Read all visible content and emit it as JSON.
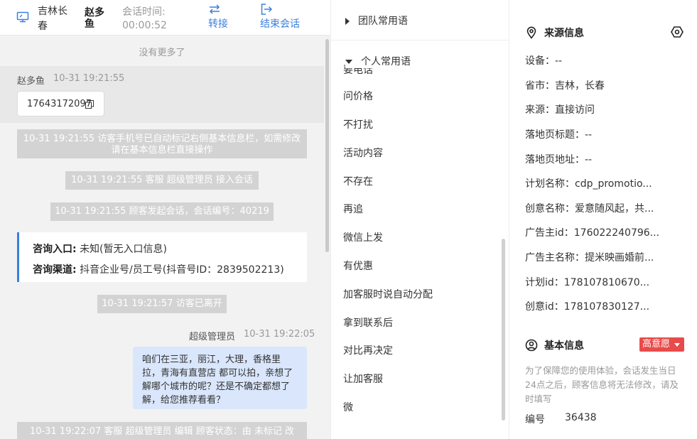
{
  "header": {
    "region": "吉林长春",
    "user": "赵多鱼",
    "session_time_label": "会话时间:",
    "session_time_value": "00:00:52",
    "transfer_label": "转接",
    "end_label": "结束会话"
  },
  "chat": {
    "no_more": "没有更多了",
    "msg1": {
      "sender": "赵多鱼",
      "time": "10-31 19:21:55",
      "text": "17643172097"
    },
    "sys1": "10-31 19:21:55 访客手机号已自动标记右侧基本信息栏，如需修改请在基本信息栏直接操作",
    "sys2": "10-31 19:21:55 客服 超级管理员 接入会话",
    "sys3": "10-31 19:21:55 顾客发起会话，会话编号：40219",
    "consult": {
      "entry_label": "咨询入口:",
      "entry_value": "未知(暂无入口信息)",
      "channel_label": "咨询渠道:",
      "channel_value": "抖音企业号/员工号(抖音号ID：2839502213)"
    },
    "sys4": "10-31 19:21:57 访客已离开",
    "agent": {
      "name": "超级管理员",
      "time": "10-31 19:22:05",
      "text": "咱们在三亚，丽江，大理，香格里拉，青海有直营店 都可以拍，亲想了解哪个城市的呢？还是不确定都想了解，给您推荐看看？"
    },
    "sys5": "10-31 19:22:07 客服 超级管理员 编辑 顾客状态：由 未标记 改"
  },
  "phrases": {
    "team_group": "团队常用语",
    "personal_group": "个人常用语",
    "cut_item": "要电话",
    "items": [
      "问价格",
      "不打扰",
      "活动内容",
      "不存在",
      "再追",
      "微信上发",
      "有优惠",
      "加客服时说自动分配",
      "拿到联系后",
      "对比再决定",
      "让加客服",
      "微"
    ]
  },
  "info": {
    "source_title": "来源信息",
    "source_items": [
      "设备：--",
      "省市：吉林，长春",
      "来源：直接访问",
      "落地页标题：--",
      "落地页地址：--",
      "计划名称：cdp_promotio...",
      "创意名称：爱意随风起，共...",
      "广告主id：176022240796...",
      "广告主名称：提米映画婚前...",
      "计划id：178107810670...",
      "创意id：178107830127..."
    ],
    "basic_title": "基本信息",
    "intent_badge": "高意愿",
    "basic_note": "为了保障您的使用体验，会话发生当日24点之后，顾客信息将无法修改，请及时填写",
    "number_label": "编号",
    "number_value": "36438"
  },
  "colors": {
    "accent": "#3b7fe0",
    "badge": "#e84b4b",
    "agent_bubble": "#d9e6fb",
    "system_bubble": "#d3d3d3"
  }
}
